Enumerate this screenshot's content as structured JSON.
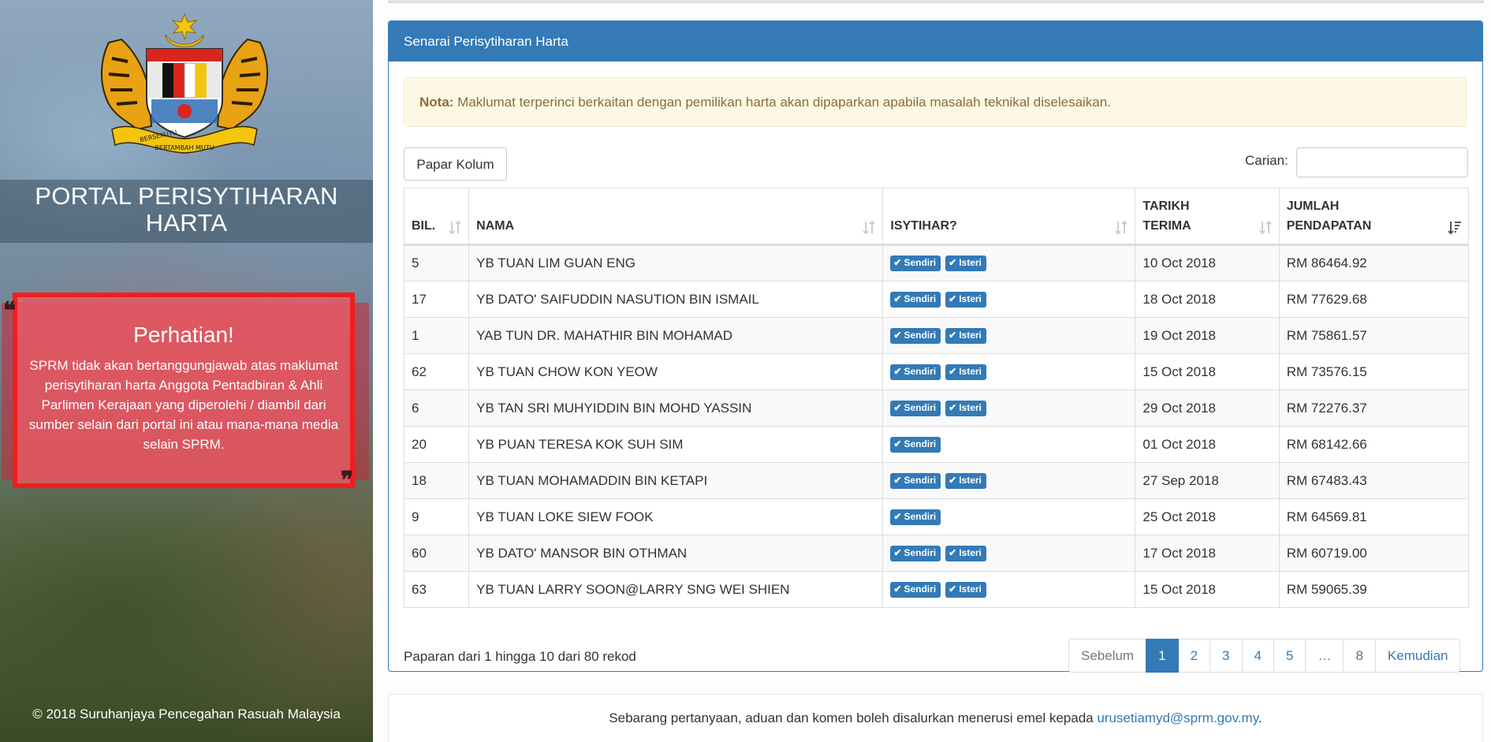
{
  "sidebar": {
    "portal_title_line1": "PORTAL PERISYTIHARAN",
    "portal_title_line2": "HARTA",
    "crest_motto_left": "BERSEKUTU",
    "crest_motto_center": "BERTAMBAH MUTU",
    "notice_title": "Perhatian!",
    "notice_body": "SPRM tidak akan bertanggungjawab atas maklumat perisytiharan harta Anggota Pentadbiran & Ahli Parlimen Kerajaan yang diperolehi / diambil dari sumber selain dari portal ini atau mana-mana media selain SPRM.",
    "copyright": "© 2018 Suruhanjaya Pencegahan Rasuah Malaysia"
  },
  "panel": {
    "heading": "Senarai Perisytiharan Harta",
    "alert_label": "Nota:",
    "alert_text": " Maklumat terperinci berkaitan dengan pemilikan harta akan dipaparkan apabila masalah teknikal diselesaikan.",
    "colvis_button": "Papar Kolum",
    "search_label": "Carian:",
    "search_value": ""
  },
  "table": {
    "headers": {
      "bil": "BIL.",
      "nama": "NAMA",
      "isytihar": "ISYTIHAR?",
      "tarikh_line1": "TARIKH",
      "tarikh_line2": "TERIMA",
      "jumlah_line1": "JUMLAH",
      "jumlah_line2": "PENDAPATAN"
    },
    "badge_sendiri": "Sendiri",
    "badge_isteri": "Isteri",
    "rows": [
      {
        "bil": "5",
        "nama": "YB TUAN LIM GUAN ENG",
        "isteri": true,
        "tarikh": "10 Oct 2018",
        "jumlah": "RM 86464.92"
      },
      {
        "bil": "17",
        "nama": "YB DATO' SAIFUDDIN NASUTION BIN ISMAIL",
        "isteri": true,
        "tarikh": "18 Oct 2018",
        "jumlah": "RM 77629.68"
      },
      {
        "bil": "1",
        "nama": "YAB TUN DR. MAHATHIR BIN MOHAMAD",
        "isteri": true,
        "tarikh": "19 Oct 2018",
        "jumlah": "RM 75861.57"
      },
      {
        "bil": "62",
        "nama": "YB TUAN CHOW KON YEOW",
        "isteri": true,
        "tarikh": "15 Oct 2018",
        "jumlah": "RM 73576.15"
      },
      {
        "bil": "6",
        "nama": "YB TAN SRI MUHYIDDIN BIN MOHD YASSIN",
        "isteri": true,
        "tarikh": "29 Oct 2018",
        "jumlah": "RM 72276.37"
      },
      {
        "bil": "20",
        "nama": "YB PUAN TERESA KOK SUH SIM",
        "isteri": false,
        "tarikh": "01 Oct 2018",
        "jumlah": "RM 68142.66"
      },
      {
        "bil": "18",
        "nama": "YB TUAN MOHAMADDIN BIN KETAPI",
        "isteri": true,
        "tarikh": "27 Sep 2018",
        "jumlah": "RM 67483.43"
      },
      {
        "bil": "9",
        "nama": "YB TUAN LOKE SIEW FOOK",
        "isteri": false,
        "tarikh": "25 Oct 2018",
        "jumlah": "RM 64569.81"
      },
      {
        "bil": "60",
        "nama": "YB DATO' MANSOR BIN OTHMAN",
        "isteri": true,
        "tarikh": "17 Oct 2018",
        "jumlah": "RM 60719.00"
      },
      {
        "bil": "63",
        "nama": "YB TUAN LARRY SOON@LARRY SNG WEI SHIEN",
        "isteri": true,
        "tarikh": "15 Oct 2018",
        "jumlah": "RM 59065.39"
      }
    ],
    "sort": {
      "column": "jumlah",
      "direction": "descending"
    }
  },
  "pagination": {
    "info": "Paparan dari 1 hingga 10 dari 80 rekod",
    "prev": "Sebelum",
    "pages": [
      "1",
      "2",
      "3",
      "4",
      "5",
      "…",
      "8"
    ],
    "active": "1",
    "next": "Kemudian"
  },
  "footer": {
    "text": "Sebarang pertanyaan, aduan dan komen boleh disalurkan menerusi emel kepada ",
    "email": "urusetiamyd@sprm.gov.my",
    "trail": "."
  },
  "colors": {
    "primary": "#337ab7",
    "alert_bg": "#fcf8e3",
    "alert_text": "#8a6d3b",
    "notice_border": "#f01e1e"
  }
}
